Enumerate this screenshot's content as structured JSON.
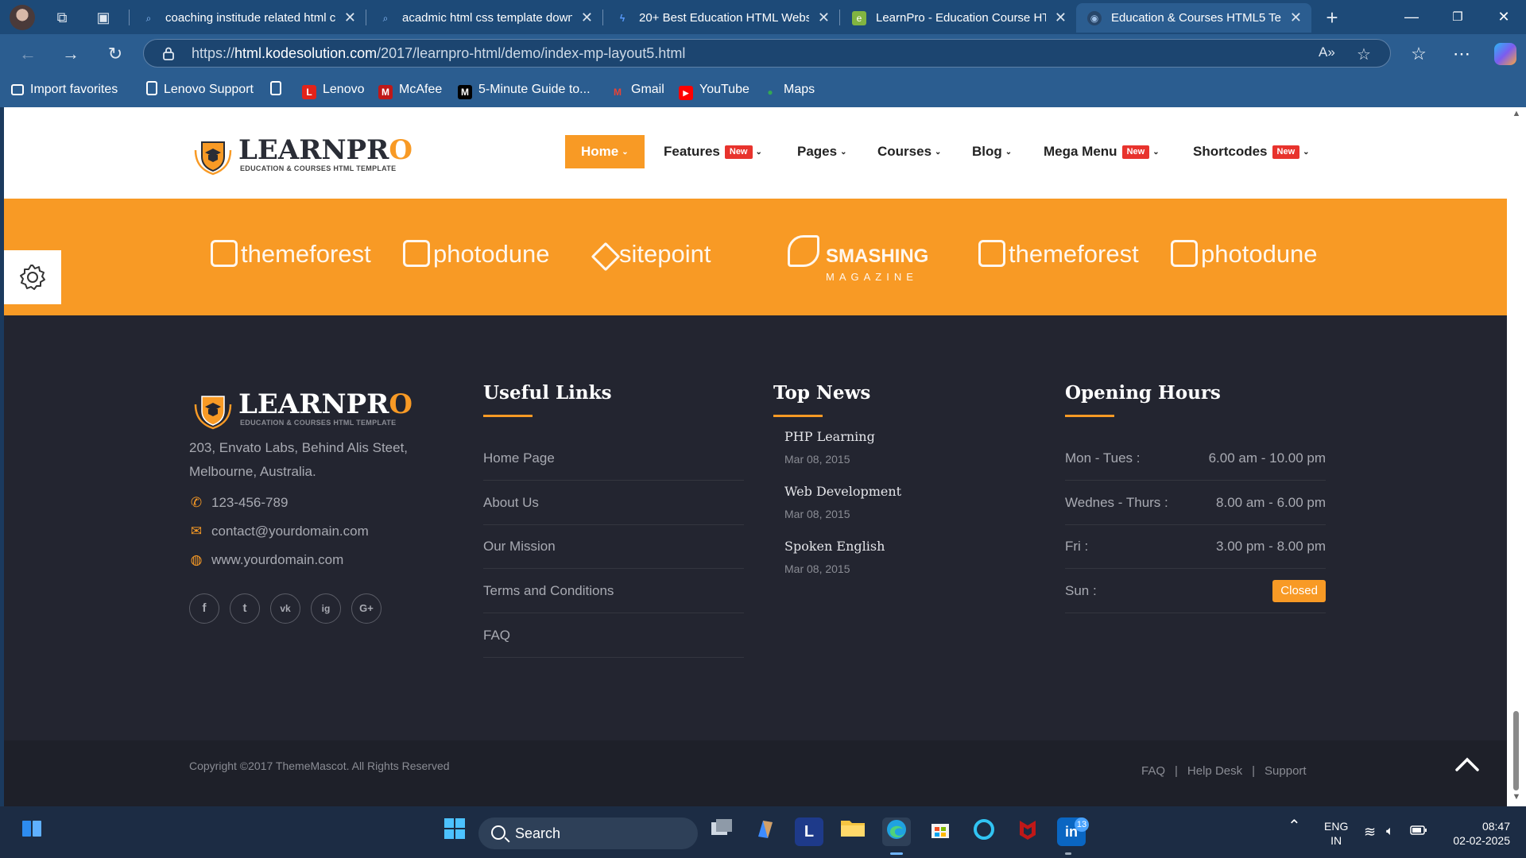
{
  "browser": {
    "tabs": [
      {
        "title": "coaching institude related html c",
        "icon": "search-icon"
      },
      {
        "title": "acadmic html css template downl",
        "icon": "search-icon"
      },
      {
        "title": "20+ Best Education HTML Websit",
        "icon": "site-icon"
      },
      {
        "title": "LearnPro - Education Course HTN",
        "icon": "envato-icon"
      },
      {
        "title": "Education & Courses HTML5 Tem",
        "icon": "kode-icon"
      }
    ],
    "url_prefix": "https://",
    "url_domain": "html.kodesolution.com",
    "url_path": "/2017/learnpro-html/demo/index-mp-layout5.html",
    "bookmarks": [
      "Import favorites",
      "Lenovo Support",
      "Lenovo",
      "McAfee",
      "5-Minute Guide to...",
      "Gmail",
      "YouTube",
      "Maps"
    ]
  },
  "site": {
    "logo_part1": "LEARNPR",
    "logo_part2": "O",
    "logo_tagline": "EDUCATION & COURSES HTML TEMPLATE",
    "menu": [
      "Home",
      "Features",
      "Pages",
      "Courses",
      "Blog",
      "Mega Menu",
      "Shortcodes"
    ],
    "new_badge": "New",
    "clients": [
      "themeforest",
      "photodune",
      "sitepoint",
      "SMASHING",
      "themeforest",
      "photodune"
    ],
    "clients_sub": "MAGAZINE"
  },
  "footer": {
    "address": "203, Envato Labs, Behind Alis Steet, Melbourne, Australia.",
    "phone": "123-456-789",
    "email": "contact@yourdomain.com",
    "website": "www.yourdomain.com",
    "social": [
      "f",
      "t",
      "vk",
      "ig",
      "G+"
    ],
    "useful_links_heading": "Useful Links",
    "useful_links": [
      "Home Page",
      "About Us",
      "Our Mission",
      "Terms and Conditions",
      "FAQ"
    ],
    "top_news_heading": "Top News",
    "news": [
      {
        "title": "PHP Learning",
        "date": "Mar 08, 2015"
      },
      {
        "title": "Web Development",
        "date": "Mar 08, 2015"
      },
      {
        "title": "Spoken English",
        "date": "Mar 08, 2015"
      }
    ],
    "opening_hours_heading": "Opening Hours",
    "hours": [
      {
        "day": "Mon - Tues :",
        "time": "6.00 am - 10.00 pm"
      },
      {
        "day": "Wednes - Thurs :",
        "time": "8.00 am - 6.00 pm"
      },
      {
        "day": "Fri :",
        "time": "3.00 pm - 8.00 pm"
      },
      {
        "day": "Sun :",
        "time": "Closed"
      }
    ],
    "copyright": "Copyright ©2017 ThemeMascot. All Rights Reserved",
    "bottom_links": [
      "FAQ",
      "Help Desk",
      "Support"
    ]
  },
  "taskbar": {
    "search_label": "Search",
    "lang_top": "ENG",
    "lang_bottom": "IN",
    "time": "08:47",
    "date": "02-02-2025",
    "notification_count": "13"
  },
  "colors": {
    "accent": "#f89a25",
    "footer_bg": "#232530",
    "browser_bg": "#2b5d90"
  }
}
